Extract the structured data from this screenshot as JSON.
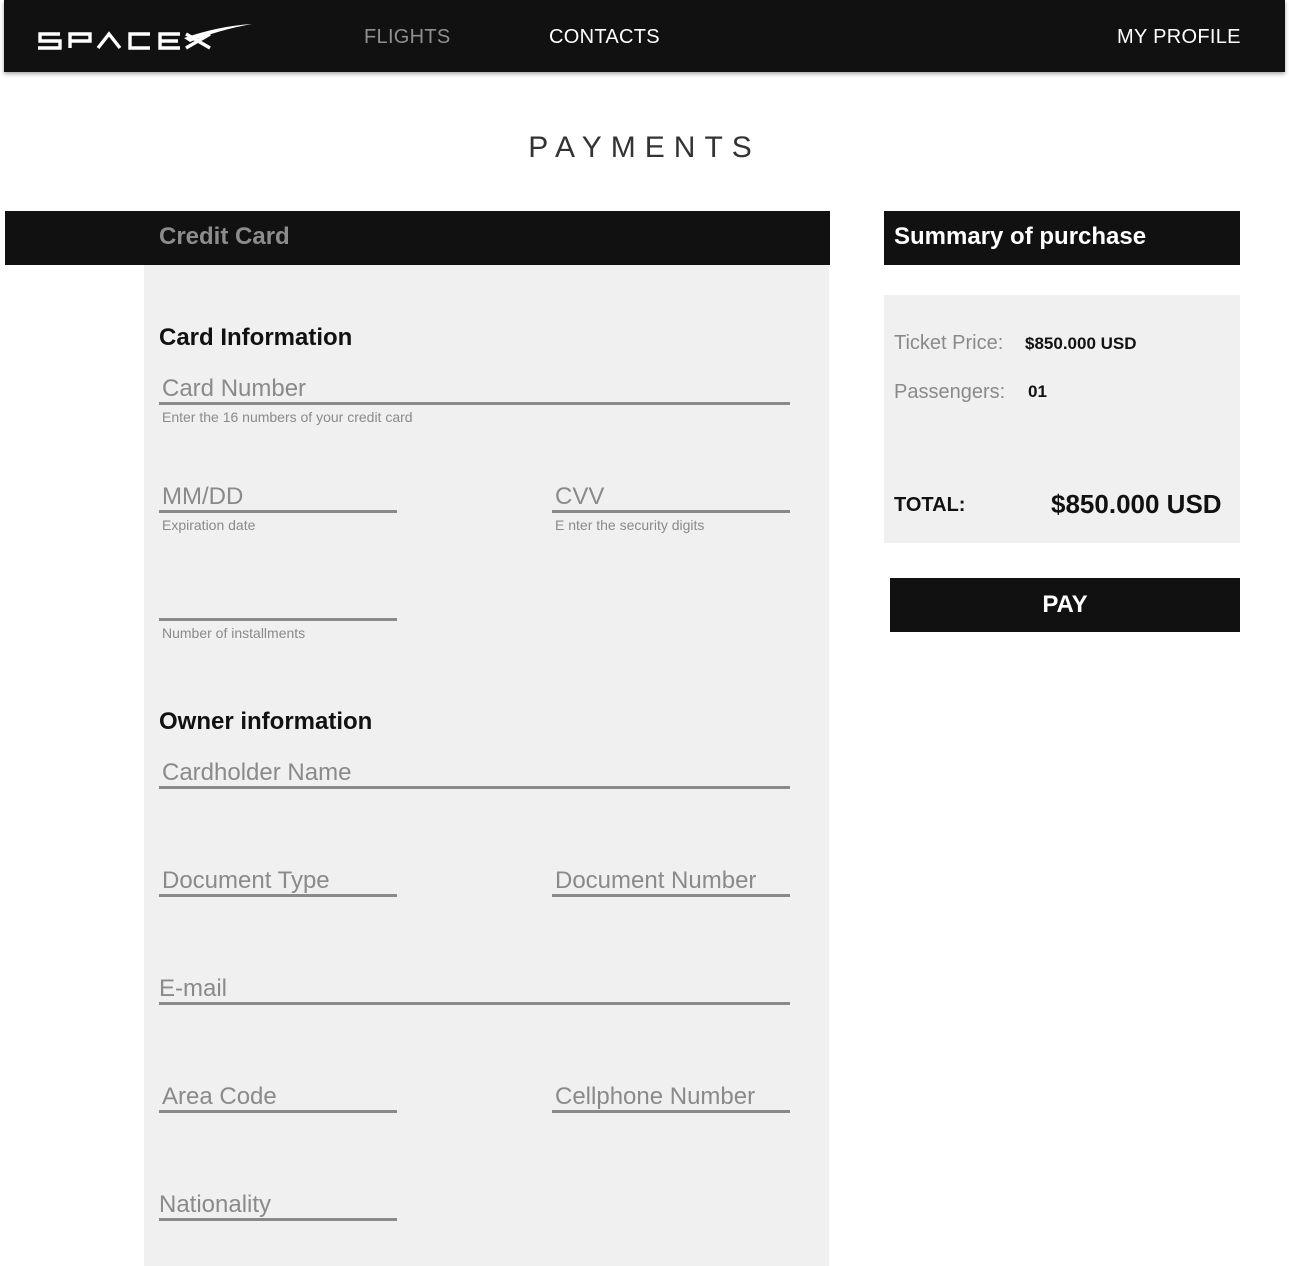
{
  "nav": {
    "logo_text": "SPACEX",
    "links": [
      "FLIGHTS",
      "CONTACTS"
    ],
    "profile": "MY PROFILE"
  },
  "page_title": "PAYMENTS",
  "credit_card": {
    "header": "Credit Card",
    "card_section_title": "Card Information",
    "card_number": {
      "placeholder": "Card Number",
      "hint": "Enter the 16 numbers of your credit card"
    },
    "expiration": {
      "placeholder": "MM/DD",
      "hint": "Expiration date"
    },
    "cvv": {
      "placeholder": "CVV",
      "hint": "E nter the security digits"
    },
    "installments": {
      "placeholder": "",
      "hint": "Number of installments"
    },
    "owner_section_title": "Owner information",
    "cardholder_name": {
      "placeholder": "Cardholder Name"
    },
    "document_type": {
      "placeholder": "Document Type"
    },
    "document_number": {
      "placeholder": "Document Number"
    },
    "email": {
      "placeholder": "E-mail"
    },
    "area_code": {
      "placeholder": "Area Code"
    },
    "cellphone": {
      "placeholder": "Cellphone Number"
    },
    "nationality": {
      "placeholder": "Nationality"
    }
  },
  "summary": {
    "header": "Summary of purchase",
    "ticket_price_label": "Ticket Price:",
    "ticket_price_value": "$850.000 USD",
    "passengers_label": "Passengers:",
    "passengers_value": "01",
    "total_label": "TOTAL:",
    "total_value": "$850.000 USD"
  },
  "pay_button": "PAY",
  "colors": {
    "nav_bg": "#111111",
    "panel_bg": "#f0f0f0",
    "muted_text": "#8a8a8a",
    "inactive_nav": "#8f8f8f"
  }
}
